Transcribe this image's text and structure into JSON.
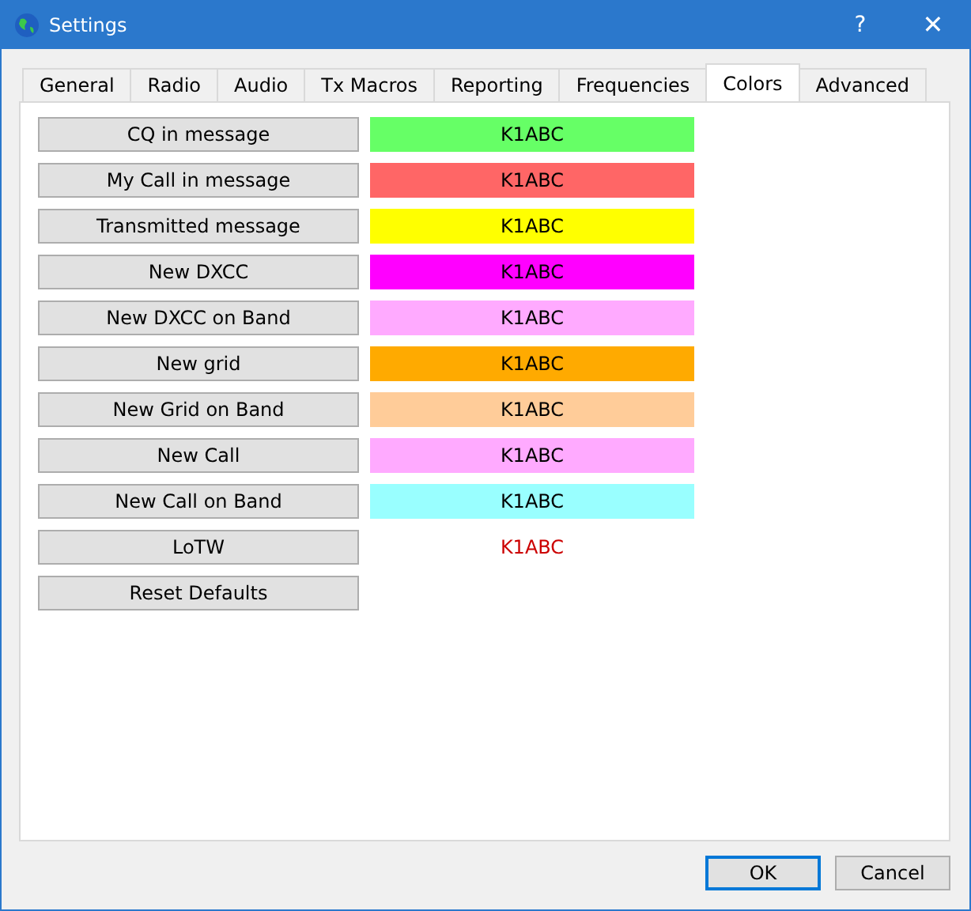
{
  "window": {
    "title": "Settings",
    "help": "?",
    "close": "✕"
  },
  "tabs": [
    {
      "label": "General",
      "selected": false
    },
    {
      "label": "Radio",
      "selected": false
    },
    {
      "label": "Audio",
      "selected": false
    },
    {
      "label": "Tx Macros",
      "selected": false
    },
    {
      "label": "Reporting",
      "selected": false
    },
    {
      "label": "Frequencies",
      "selected": false
    },
    {
      "label": "Colors",
      "selected": true
    },
    {
      "label": "Advanced",
      "selected": false
    }
  ],
  "rows": [
    {
      "button": "CQ in message",
      "sample": "K1ABC",
      "kind": "fill",
      "color": "#66ff66"
    },
    {
      "button": "My Call in message",
      "sample": "K1ABC",
      "kind": "fill",
      "color": "#ff6666"
    },
    {
      "button": "Transmitted message",
      "sample": "K1ABC",
      "kind": "fill",
      "color": "#ffff00"
    },
    {
      "button": "New DXCC",
      "sample": "K1ABC",
      "kind": "fill",
      "color": "#ff00ff"
    },
    {
      "button": "New DXCC on Band",
      "sample": "K1ABC",
      "kind": "fill",
      "color": "#ffaaff"
    },
    {
      "button": "New grid",
      "sample": "K1ABC",
      "kind": "fill",
      "color": "#ffaa00"
    },
    {
      "button": "New Grid on Band",
      "sample": "K1ABC",
      "kind": "fill",
      "color": "#ffcc99"
    },
    {
      "button": "New Call",
      "sample": "K1ABC",
      "kind": "fill",
      "color": "#ffaaff"
    },
    {
      "button": "New Call on Band",
      "sample": "K1ABC",
      "kind": "fill",
      "color": "#99ffff"
    },
    {
      "button": "LoTW",
      "sample": "K1ABC",
      "kind": "text",
      "color": "#cc0000"
    }
  ],
  "reset_button": "Reset Defaults",
  "buttons": [
    {
      "label": "OK",
      "default": true
    },
    {
      "label": "Cancel",
      "default": false
    }
  ]
}
